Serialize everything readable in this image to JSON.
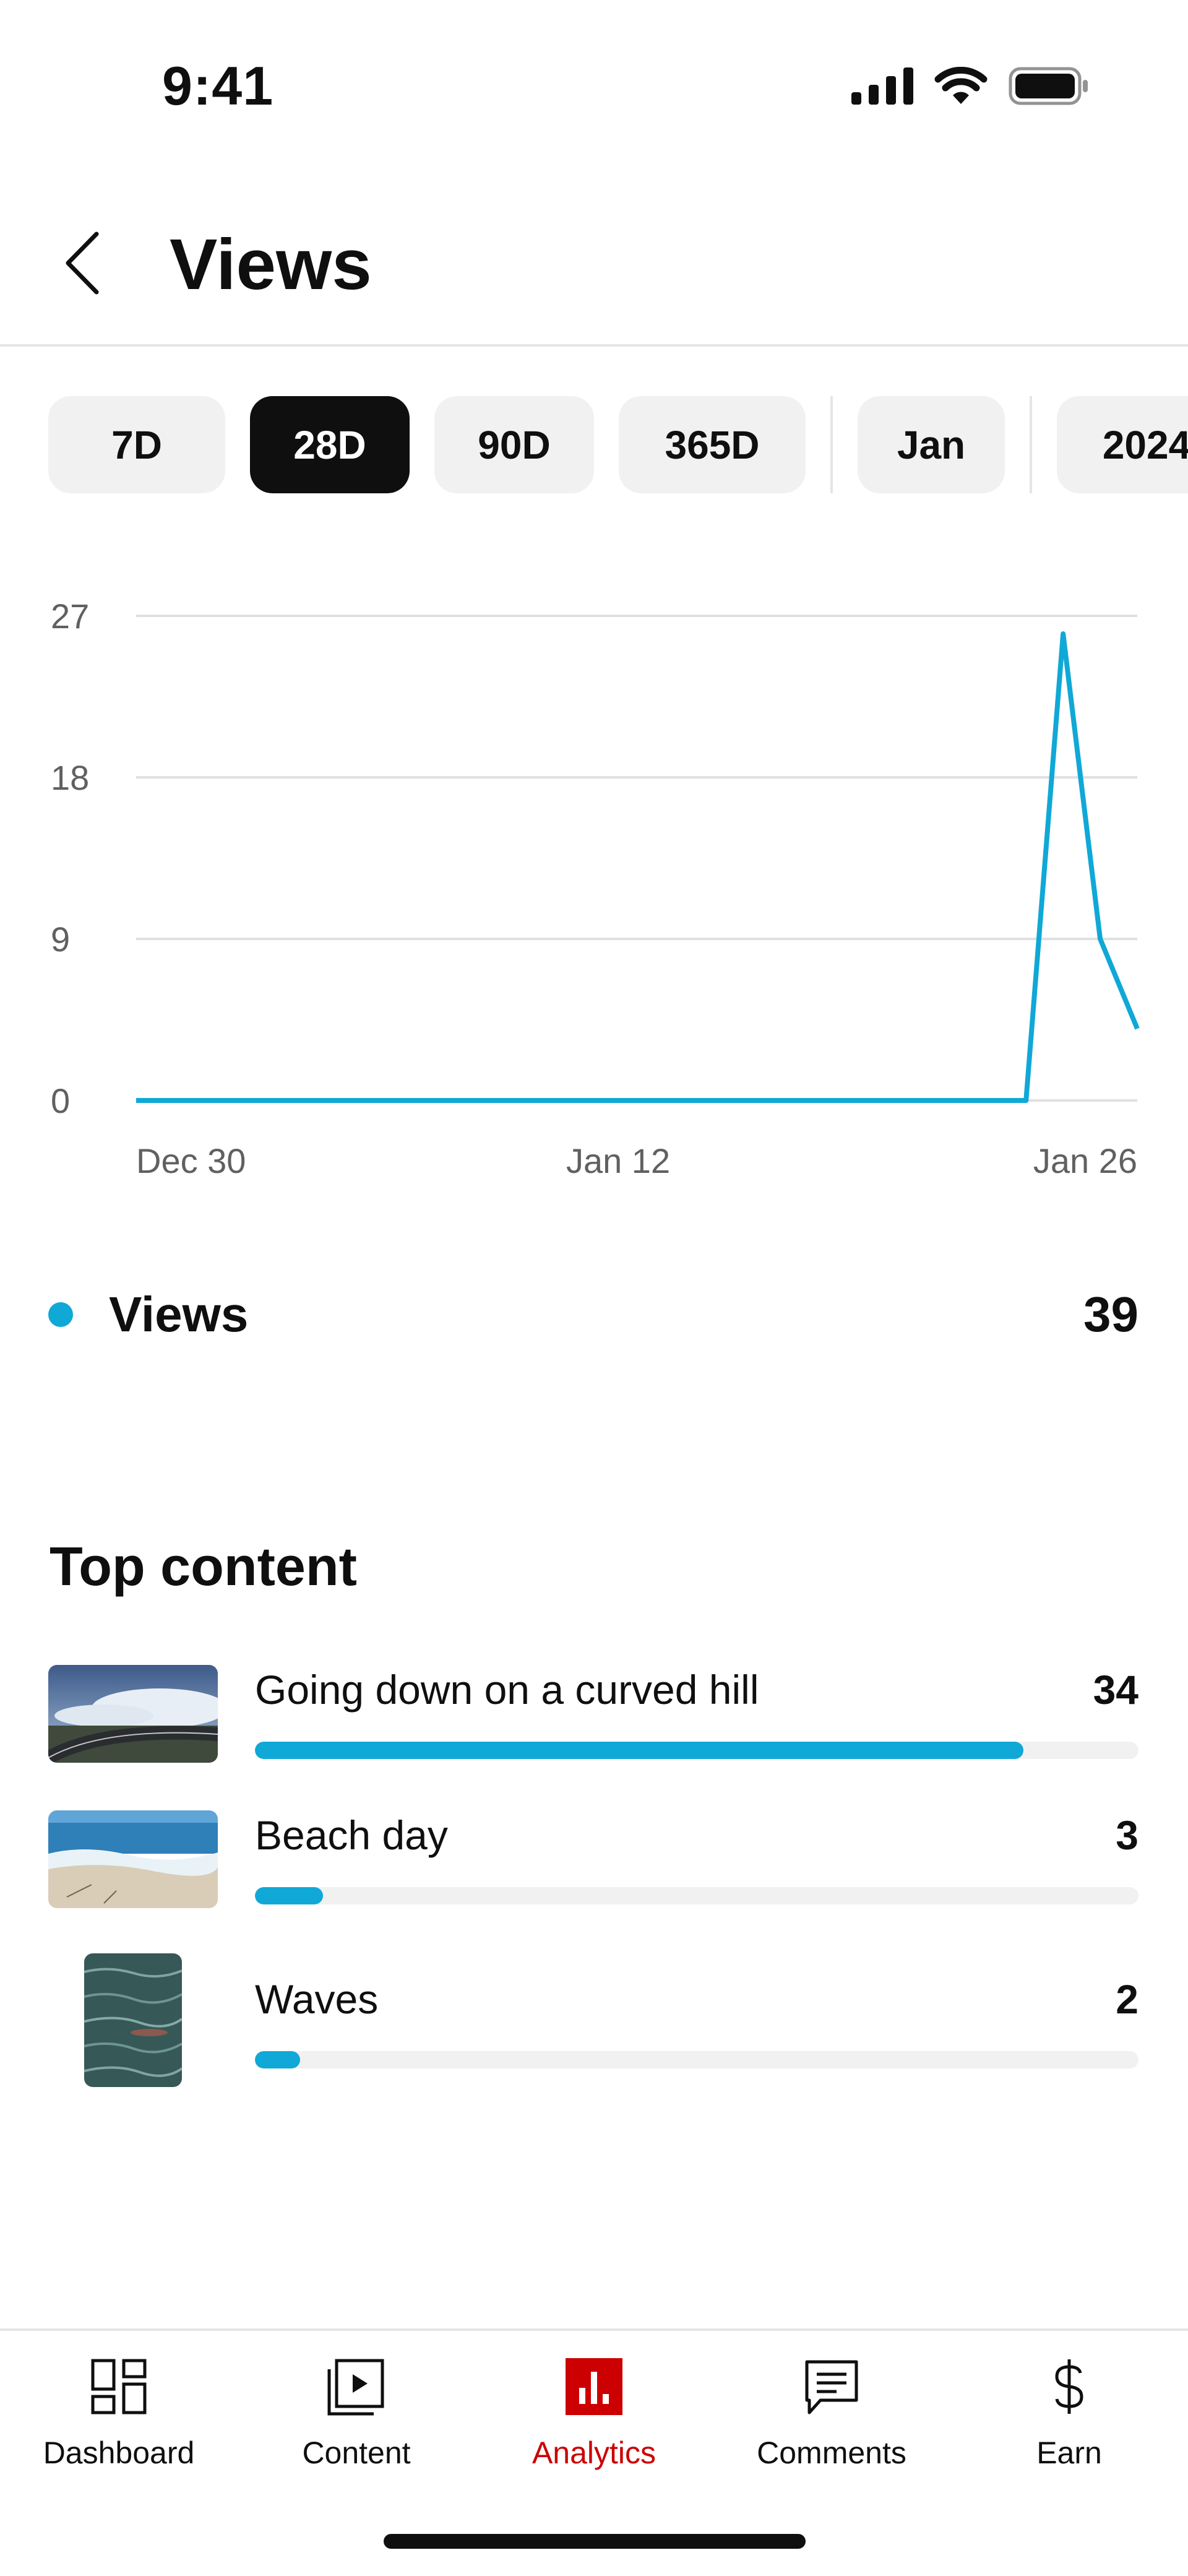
{
  "status_bar": {
    "time": "9:41"
  },
  "header": {
    "title": "Views"
  },
  "filters": {
    "chips": [
      "7D",
      "28D",
      "90D",
      "365D",
      "Jan",
      "2024"
    ],
    "selected": "28D"
  },
  "chart_data": {
    "type": "line",
    "x": [
      "Dec 30",
      "Dec 31",
      "Jan 1",
      "Jan 2",
      "Jan 3",
      "Jan 4",
      "Jan 5",
      "Jan 6",
      "Jan 7",
      "Jan 8",
      "Jan 9",
      "Jan 10",
      "Jan 11",
      "Jan 12",
      "Jan 13",
      "Jan 14",
      "Jan 15",
      "Jan 16",
      "Jan 17",
      "Jan 18",
      "Jan 19",
      "Jan 20",
      "Jan 21",
      "Jan 22",
      "Jan 23",
      "Jan 24",
      "Jan 25",
      "Jan 26"
    ],
    "series": [
      {
        "name": "Views",
        "color": "#10a8d6",
        "values": [
          0,
          0,
          0,
          0,
          0,
          0,
          0,
          0,
          0,
          0,
          0,
          0,
          0,
          0,
          0,
          0,
          0,
          0,
          0,
          0,
          0,
          0,
          0,
          0,
          0,
          26,
          9,
          4
        ]
      }
    ],
    "x_tick_labels": [
      "Dec 30",
      "Jan 12",
      "Jan 26"
    ],
    "y_ticks": [
      0,
      9,
      18,
      27
    ],
    "ylim": [
      0,
      27
    ],
    "grid": true
  },
  "legend": {
    "label": "Views",
    "total": "39",
    "color": "#10a8d6"
  },
  "top_content": {
    "title": "Top content",
    "items": [
      {
        "title": "Going down on a curved hill",
        "count": "34",
        "share": 0.87,
        "thumb": "curved-hill-road-image"
      },
      {
        "title": "Beach day",
        "count": "3",
        "share": 0.077,
        "thumb": "beach-waves-image"
      },
      {
        "title": "Waves",
        "count": "2",
        "share": 0.051,
        "thumb": "ocean-water-image"
      }
    ]
  },
  "bottom_nav": {
    "items": [
      {
        "label": "Dashboard",
        "icon": "dashboard-icon"
      },
      {
        "label": "Content",
        "icon": "content-play-icon"
      },
      {
        "label": "Analytics",
        "icon": "analytics-chart-icon"
      },
      {
        "label": "Comments",
        "icon": "comments-icon"
      },
      {
        "label": "Earn",
        "icon": "dollar-icon"
      }
    ],
    "active": "Analytics"
  },
  "colors": {
    "accent": "#10a8d6",
    "brand_red": "#cc0000"
  }
}
